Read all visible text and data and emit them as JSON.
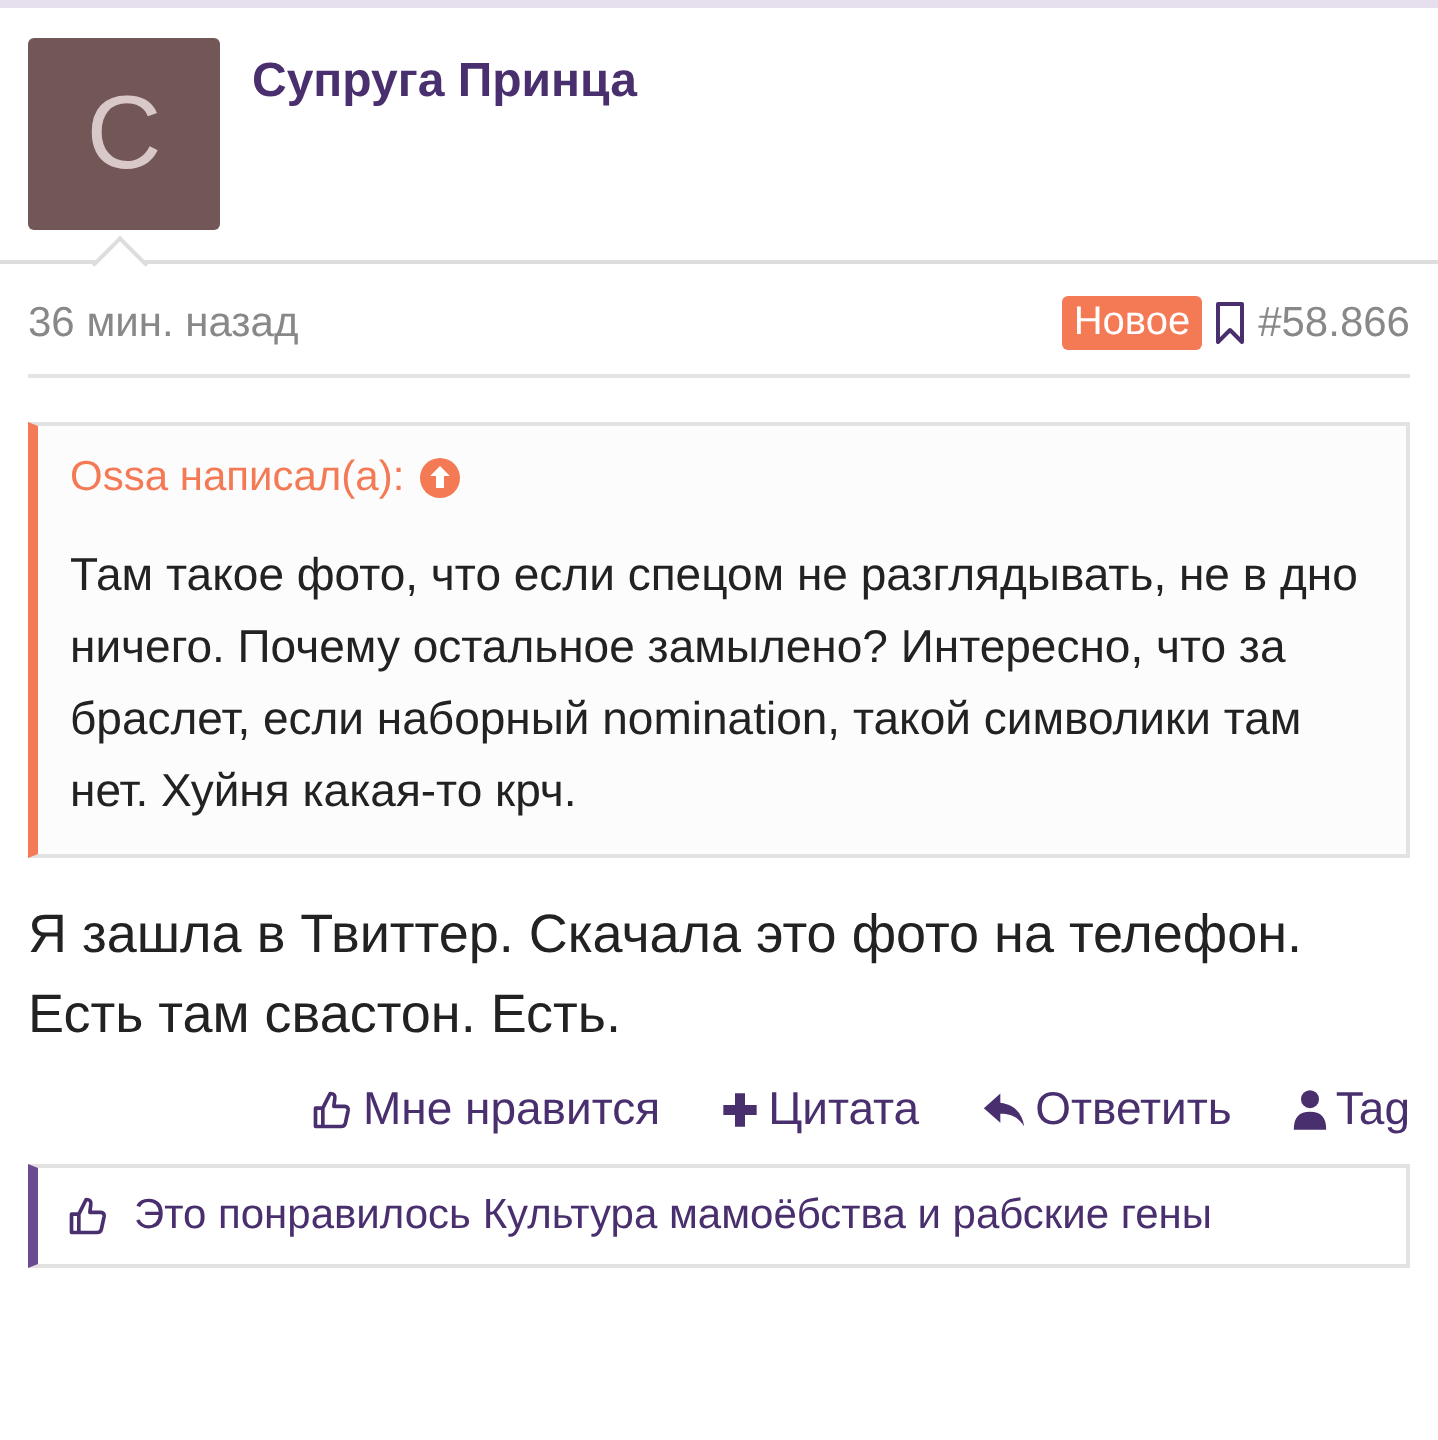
{
  "post": {
    "avatar_letter": "С",
    "author": "Супруга Принца",
    "time": "36 мин. назад",
    "badge": "Новое",
    "number": "#58.866",
    "quote": {
      "author": "Ossa написал(a):",
      "text": "Там такое фото, что если спецом не разглядывать, не в дно ничего. Почему остальное замылено? Интересно, что за браслет, если наборный nomination, такой символики там нет. Хуйня какая-то крч."
    },
    "body": "Я зашла в Твиттер. Скачала это фото на телефон. Есть там свастон. Есть.",
    "actions": [
      {
        "kind": "like",
        "label": "Мне нравится"
      },
      {
        "kind": "quote",
        "label": "Цитата"
      },
      {
        "kind": "reply",
        "label": "Ответить"
      },
      {
        "kind": "tag",
        "label": "Tag"
      }
    ],
    "likes": "Это понравилось Культура мамоёбства и рабские гены"
  }
}
